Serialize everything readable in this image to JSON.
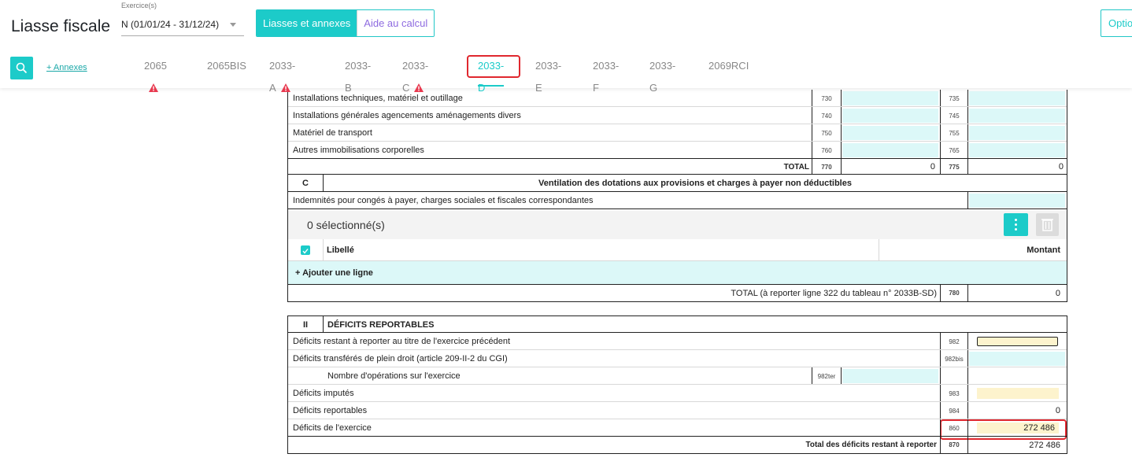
{
  "header": {
    "title": "Liasse fiscale",
    "exercise_label": "Exercice(s)",
    "exercise_value": "N (01/01/24 - 31/12/24)",
    "btn_liasses": "Liasses et annexes",
    "btn_aide": "Aide au calcul",
    "btn_options": "Optio",
    "annexes_link": "+ Annexes"
  },
  "tabs": [
    {
      "label": "2065",
      "warning": true
    },
    {
      "label": "2065BIS",
      "warning": false
    },
    {
      "label": "2033-A",
      "warning": true
    },
    {
      "label": "2033-B",
      "warning": false
    },
    {
      "label": "2033-C",
      "warning": true
    },
    {
      "label": "2033-D",
      "warning": false,
      "active": true
    },
    {
      "label": "2033-E",
      "warning": false
    },
    {
      "label": "2033-F",
      "warning": false
    },
    {
      "label": "2033-G",
      "warning": false
    },
    {
      "label": "2069RCI",
      "warning": false
    }
  ],
  "immo_rows": [
    {
      "label": "Installations techniques, matériel et outillage",
      "code1": "730",
      "code2": "735"
    },
    {
      "label": "Installations générales agencements aménagements divers",
      "code1": "740",
      "code2": "745"
    },
    {
      "label": "Matériel de transport",
      "code1": "750",
      "code2": "755"
    },
    {
      "label": "Autres immobilisations corporelles",
      "code1": "760",
      "code2": "765"
    }
  ],
  "immo_total": {
    "label": "TOTAL",
    "code1": "770",
    "value1": "0",
    "code2": "775",
    "value2": "0"
  },
  "section_c": {
    "letter": "C",
    "title": "Ventilation des dotations aux provisions et charges à payer non déductibles"
  },
  "indemnites_label": "Indemnités pour congés à payer, charges sociales et fiscales correspondantes",
  "selection": {
    "text": "0 sélectionné(s)",
    "col_libelle": "Libellé",
    "col_montant": "Montant",
    "add_line": "+ Ajouter une ligne"
  },
  "total_c": {
    "label": "TOTAL (à reporter ligne 322 du tableau n° 2033B-SD)",
    "code": "780",
    "value": "0"
  },
  "section_ii": {
    "letter": "II",
    "title": "DÉFICITS REPORTABLES"
  },
  "deficits": {
    "r1": {
      "label": "Déficits restant à reporter au titre de l'exercice précédent",
      "code": "982",
      "value": ""
    },
    "r2": {
      "label": "Déficits transférés de plein droit (article 209-II-2 du CGI)",
      "code": "982bis",
      "value": ""
    },
    "r3": {
      "label": "Nombre d'opérations sur l'exercice",
      "code": "982ter",
      "value": ""
    },
    "r4": {
      "label": "Déficits imputés",
      "code": "983",
      "value": ""
    },
    "r5": {
      "label": "Déficits reportables",
      "code": "984",
      "value": "0"
    },
    "r6": {
      "label": "Déficits de l'exercice",
      "code": "860",
      "value": "272 486"
    },
    "total": {
      "label": "Total des déficits restant à reporter",
      "code": "870",
      "value": "272 486"
    }
  },
  "colors": {
    "accent": "#1ccbc9",
    "highlight": "#e0282f",
    "cyan_fill": "#dcf8f8",
    "yellow_fill": "#fdf3cd"
  }
}
